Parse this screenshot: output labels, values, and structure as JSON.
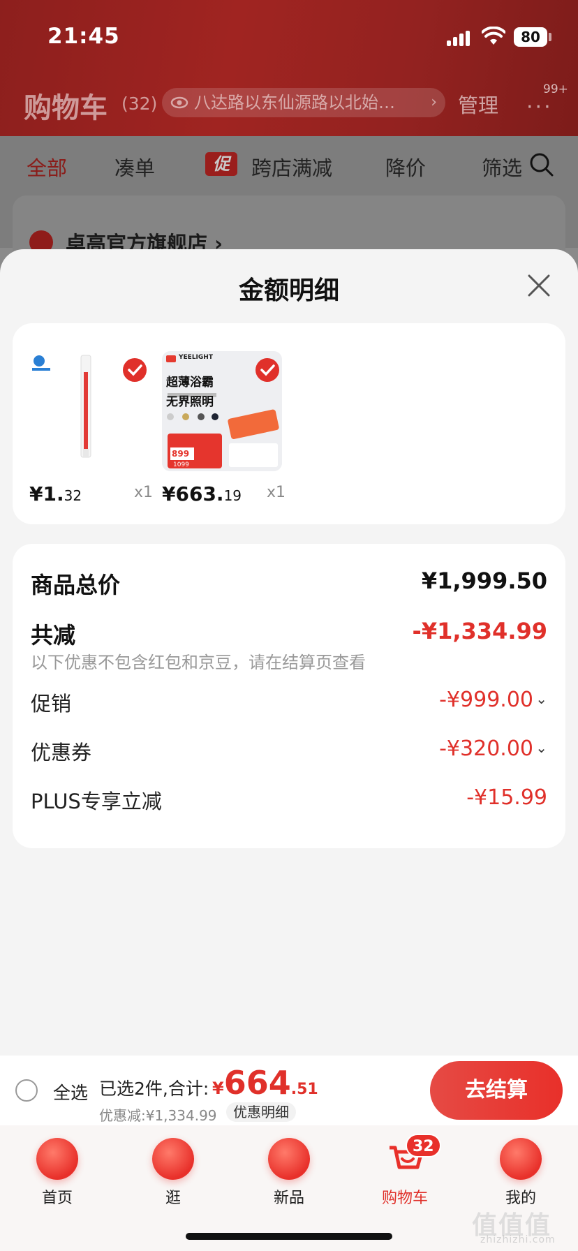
{
  "status_bar": {
    "time": "21:45",
    "battery": "80"
  },
  "header": {
    "title": "购物车",
    "count": "(32)",
    "address": "八达路以东仙源路以北始…",
    "manage": "管理",
    "more_badge": "99+"
  },
  "filter_tabs": [
    {
      "label": "全部"
    },
    {
      "label": "凑单"
    },
    {
      "label": "跨店满减",
      "tag": "促"
    },
    {
      "label": "降价"
    },
    {
      "label": "筛选"
    }
  ],
  "store": {
    "name": "卓高官方旗舰店 ›"
  },
  "sheet": {
    "title": "金额明细",
    "goods": [
      {
        "price_int": "¥1.",
        "price_dec": "32",
        "qty": "x1"
      },
      {
        "price_int": "¥663.",
        "price_dec": "19",
        "qty": "x1",
        "brand": "YEELIGHT",
        "headline1": "超薄浴霸",
        "headline2": "无界照明",
        "promo_price": "899",
        "old_price": "1099"
      }
    ],
    "total_label": "商品总价",
    "total_value": "¥1,999.50",
    "reduce_label": "共减",
    "reduce_value": "-¥1,334.99",
    "note": "以下优惠不包含红包和京豆，请在结算页查看",
    "lines": [
      {
        "label": "促销",
        "value": "-¥999.00"
      },
      {
        "label": "优惠券",
        "value": "-¥320.00"
      },
      {
        "label": "PLUS专享立减",
        "value": "-¥15.99"
      }
    ]
  },
  "checkout": {
    "select_all": "全选",
    "selected_text": "已选2件,合计:",
    "currency": "¥",
    "amount_int": "664",
    "amount_dec": ".51",
    "discount_text": "优惠减:¥1,334.99",
    "detail_label": "优惠明细",
    "button": "去结算"
  },
  "tab_bar": [
    {
      "label": "首页"
    },
    {
      "label": "逛"
    },
    {
      "label": "新品"
    },
    {
      "label": "购物车",
      "badge": "32"
    },
    {
      "label": "我的"
    }
  ],
  "watermark": {
    "main": "值值值",
    "sub": "zhizhizhi.com"
  }
}
